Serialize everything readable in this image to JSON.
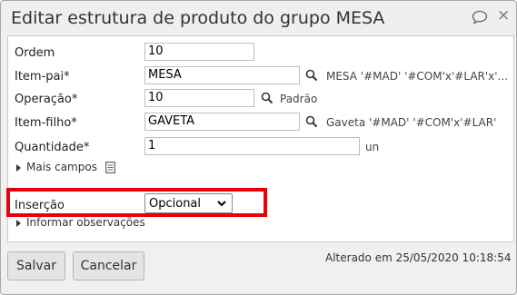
{
  "dialog": {
    "title": "Editar estrutura de produto do grupo MESA",
    "close_glyph": "×"
  },
  "form": {
    "ordem": {
      "label": "Ordem",
      "value": "10"
    },
    "item_pai": {
      "label": "Item-pai*",
      "value": "MESA",
      "description": "MESA '#MAD' '#COM'x'#LAR'x'..."
    },
    "operacao": {
      "label": "Operação*",
      "value": "10",
      "description": "Padrão"
    },
    "item_filho": {
      "label": "Item-filho*",
      "value": "GAVETA",
      "description": "Gaveta '#MAD' '#COM'x'#LAR'"
    },
    "quantidade": {
      "label": "Quantidade*",
      "value": "1",
      "unit": "un"
    },
    "mais_campos": "Mais campos",
    "insercao": {
      "label": "Inserção",
      "selected": "Opcional"
    },
    "informar_obs": "Informar observações"
  },
  "footer": {
    "save_label": "Salvar",
    "cancel_label": "Cancelar",
    "updated_text": "Alterado em 25/05/2020 10:18:54"
  },
  "icons": {
    "search": "search-icon",
    "chat": "chat-bubble-icon",
    "notes": "document-icon",
    "close": "close-icon",
    "dropdown": "chevron-down-icon"
  },
  "colors": {
    "highlight": "#e8000b",
    "title_bar": "#efefef",
    "panel_bg": "#ffffff"
  }
}
